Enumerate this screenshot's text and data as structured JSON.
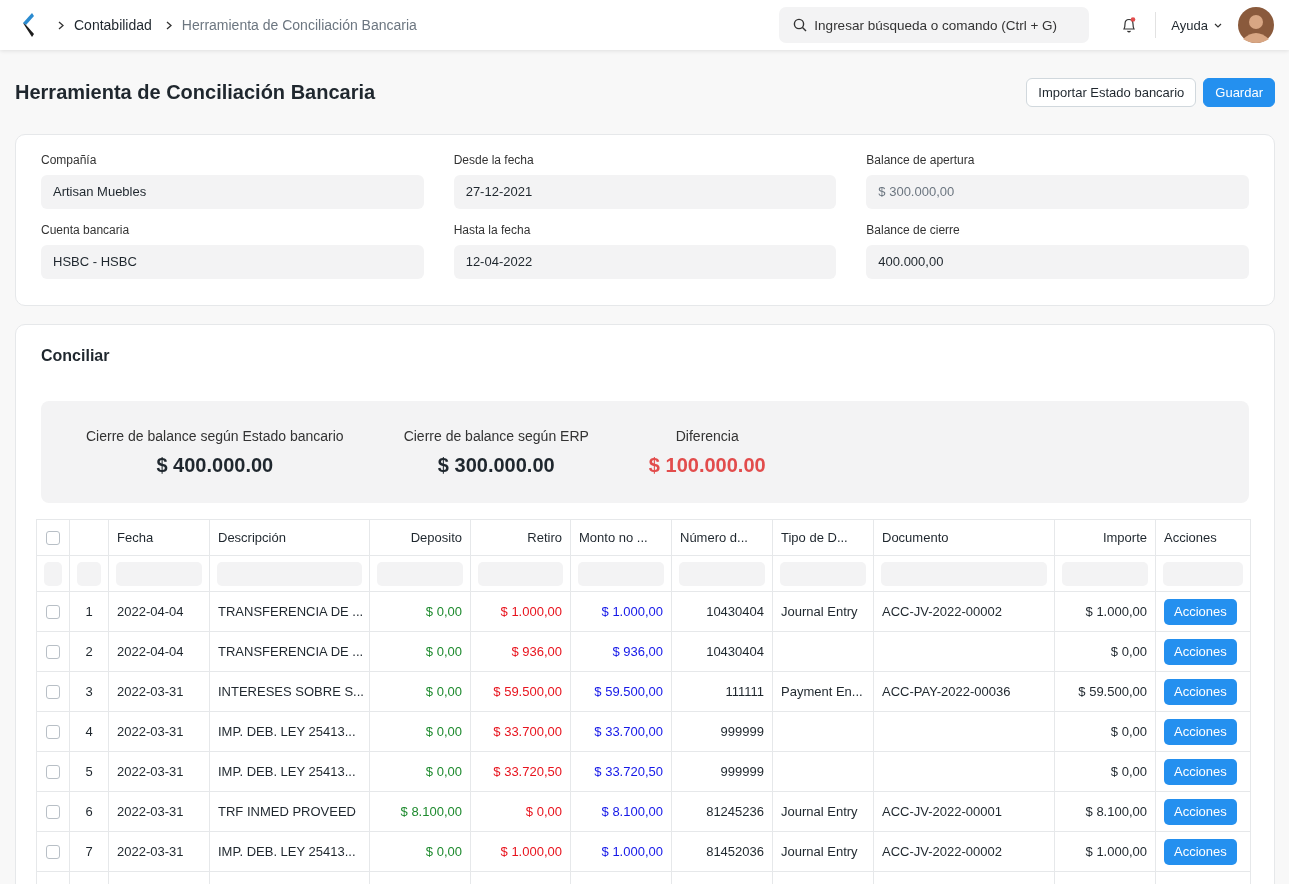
{
  "navbar": {
    "breadcrumbs": [
      {
        "label": "Contabilidad",
        "current": false
      },
      {
        "label": "Herramienta de Conciliación Bancaria",
        "current": true
      }
    ],
    "search": {
      "placeholder": "Ingresar búsqueda o comando (Ctrl + G)"
    },
    "notifications": {
      "unread": true
    },
    "help_menu": {
      "label": "Ayuda"
    }
  },
  "page": {
    "title": "Herramienta de Conciliación Bancaria",
    "buttons": [
      {
        "label": "Importar Estado bancario",
        "kind": "secondary"
      },
      {
        "label": "Guardar",
        "kind": "primary"
      }
    ]
  },
  "form": {
    "columns": [
      [
        {
          "label": "Compañía",
          "value": "Artisan Muebles",
          "disabled": false
        },
        {
          "label": "Cuenta bancaria",
          "value": "HSBC - HSBC",
          "disabled": false
        }
      ],
      [
        {
          "label": "Desde la fecha",
          "value": "27-12-2021",
          "disabled": false
        },
        {
          "label": "Hasta la fecha",
          "value": "12-04-2022",
          "disabled": false
        }
      ],
      [
        {
          "label": "Balance de apertura",
          "value": "$ 300.000,00",
          "disabled": true
        },
        {
          "label": "Balance de cierre",
          "value": "400.000,00",
          "disabled": false
        }
      ]
    ]
  },
  "reconcile": {
    "title": "Conciliar",
    "summary": [
      {
        "label": "Cierre de balance según Estado bancario",
        "value": "$ 400.000.00",
        "kind": "neutral"
      },
      {
        "label": "Cierre de balance según ERP",
        "value": "$ 300.000.00",
        "kind": "neutral"
      },
      {
        "label": "Diferencia",
        "value": "$ 100.000.00",
        "kind": "alert"
      }
    ],
    "table": {
      "header_checked": false,
      "columns": [
        {
          "kind": "index"
        },
        {
          "label": "Fecha",
          "kind": "text"
        },
        {
          "label": "Descripción",
          "kind": "text"
        },
        {
          "label": "Deposito",
          "kind": "deposit"
        },
        {
          "label": "Retiro",
          "kind": "withdrawal"
        },
        {
          "label": "Monto no ...",
          "kind": "unreconciled"
        },
        {
          "label": "Número d...",
          "kind": "number"
        },
        {
          "label": "Tipo de D...",
          "kind": "text"
        },
        {
          "label": "Documento",
          "kind": "text"
        },
        {
          "label": "Importe",
          "kind": "amount"
        },
        {
          "label": "Acciones",
          "kind": "action"
        }
      ],
      "rows": [
        {
          "checked": false,
          "cells": [
            "1",
            "2022-04-04",
            "TRANSFERENCIA DE ...",
            "$ 0,00",
            "$ 1.000,00",
            "$ 1.000,00",
            "10430404",
            "Journal Entry",
            "ACC-JV-2022-00002",
            "$ 1.000,00",
            "Acciones"
          ]
        },
        {
          "checked": false,
          "cells": [
            "2",
            "2022-04-04",
            "TRANSFERENCIA DE ...",
            "$ 0,00",
            "$ 936,00",
            "$ 936,00",
            "10430404",
            null,
            null,
            "$ 0,00",
            "Acciones"
          ]
        },
        {
          "checked": false,
          "cells": [
            "3",
            "2022-03-31",
            "INTERESES SOBRE S...",
            "$ 0,00",
            "$ 59.500,00",
            "$ 59.500,00",
            "111111",
            "Payment En...",
            "ACC-PAY-2022-00036",
            "$ 59.500,00",
            "Acciones"
          ]
        },
        {
          "checked": false,
          "cells": [
            "4",
            "2022-03-31",
            "IMP. DEB. LEY 25413...",
            "$ 0,00",
            "$ 33.700,00",
            "$ 33.700,00",
            "999999",
            null,
            null,
            "$ 0,00",
            "Acciones"
          ]
        },
        {
          "checked": false,
          "cells": [
            "5",
            "2022-03-31",
            "IMP. DEB. LEY 25413...",
            "$ 0,00",
            "$ 33.720,50",
            "$ 33.720,50",
            "999999",
            null,
            null,
            "$ 0,00",
            "Acciones"
          ]
        },
        {
          "checked": false,
          "cells": [
            "6",
            "2022-03-31",
            "TRF INMED PROVEED",
            "$ 8.100,00",
            "$ 0,00",
            "$ 8.100,00",
            "81245236",
            "Journal Entry",
            "ACC-JV-2022-00001",
            "$ 8.100,00",
            "Acciones"
          ]
        },
        {
          "checked": false,
          "cells": [
            "7",
            "2022-03-31",
            "IMP. DEB. LEY 25413...",
            "$ 0,00",
            "$ 1.000,00",
            "$ 1.000,00",
            "81452036",
            "Journal Entry",
            "ACC-JV-2022-00002",
            "$ 1.000,00",
            "Acciones"
          ]
        }
      ]
    }
  }
}
